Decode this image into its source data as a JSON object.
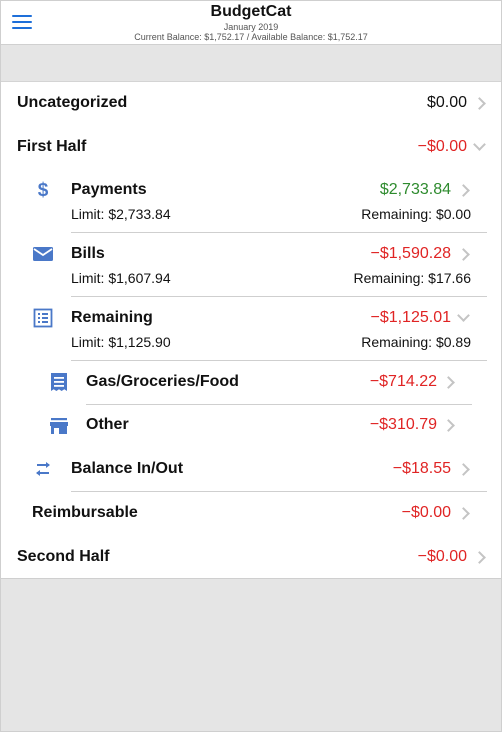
{
  "header": {
    "title": "BudgetCat",
    "month": "January 2019",
    "balances": "Current Balance: $1,752.17 / Available Balance: $1,752.17"
  },
  "rows": {
    "uncategorized": {
      "label": "Uncategorized",
      "amount": "$0.00"
    },
    "first_half": {
      "label": "First Half",
      "amount": "−$0.00"
    },
    "payments": {
      "label": "Payments",
      "amount": "$2,733.84",
      "limit": "Limit: $2,733.84",
      "remaining": "Remaining: $0.00"
    },
    "bills": {
      "label": "Bills",
      "amount": "−$1,590.28",
      "limit": "Limit: $1,607.94",
      "remaining": "Remaining: $17.66"
    },
    "remaining": {
      "label": "Remaining",
      "amount": "−$1,125.01",
      "limit": "Limit: $1,125.90",
      "remaining": "Remaining: $0.89"
    },
    "gas": {
      "label": "Gas/Groceries/Food",
      "amount": "−$714.22"
    },
    "other": {
      "label": "Other",
      "amount": "−$310.79"
    },
    "balance_inout": {
      "label": "Balance In/Out",
      "amount": "−$18.55"
    },
    "reimbursable": {
      "label": "Reimbursable",
      "amount": "−$0.00"
    },
    "second_half": {
      "label": "Second Half",
      "amount": "−$0.00"
    }
  },
  "colors": {
    "accent": "#1e6fd9",
    "icon": "#4a78c8",
    "negative": "#e02424",
    "positive": "#2e8b2e"
  }
}
